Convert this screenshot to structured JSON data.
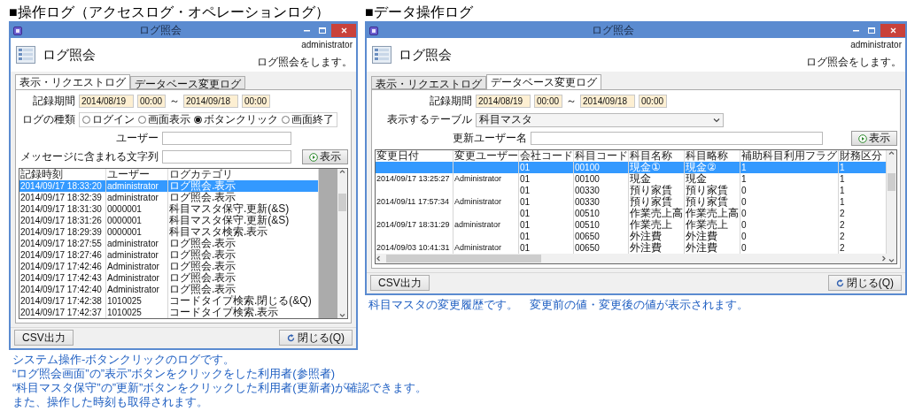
{
  "operation_log": {
    "heading": "■操作ログ（アクセスログ・オペレーションログ）",
    "window": {
      "title": "ログ照会",
      "user": "administrator",
      "page_title": "ログ照会",
      "description": "ログ照会をします。",
      "tabs": [
        {
          "label": "表示・リクエストログ",
          "selected": true
        },
        {
          "label": "データベース変更ログ",
          "selected": false
        }
      ],
      "footer_buttons": [
        {
          "kind": "csv",
          "label": "CSV出力"
        },
        {
          "kind": "close",
          "label": "閉じる(Q)"
        }
      ]
    },
    "form": {
      "period_label": "記録期間",
      "from_date": "2014/08/19",
      "from_time": "00:00",
      "tilde": "～",
      "to_date": "2014/09/18",
      "to_time": "00:00",
      "log_type_label": "ログの種類",
      "log_types": [
        {
          "label": "ログイン",
          "selected": false
        },
        {
          "label": "画面表示",
          "selected": false
        },
        {
          "label": "ボタンクリック",
          "selected": true
        },
        {
          "label": "画面終了",
          "selected": false
        }
      ],
      "user_label": "ユーザー",
      "message_label": "メッセージに含まれる文字列",
      "show_button": "表示"
    },
    "table": {
      "columns": [
        "記録時刻",
        "ユーザー",
        "ログカテゴリ"
      ],
      "rows": [
        {
          "cells": [
            "2014/09/17 18:33:20",
            "administrator",
            "ログ照会.表示"
          ],
          "selected": true
        },
        {
          "cells": [
            "2014/09/17 18:32:39",
            "administrator",
            "ログ照会.表示"
          ],
          "selected": false
        },
        {
          "cells": [
            "2014/09/17 18:31:30",
            "0000001",
            "科目マスタ保守.更新(&S)"
          ],
          "selected": false
        },
        {
          "cells": [
            "2014/09/17 18:31:26",
            "0000001",
            "科目マスタ保守.更新(&S)"
          ],
          "selected": false
        },
        {
          "cells": [
            "2014/09/17 18:29:39",
            "0000001",
            "科目マスタ検索.表示"
          ],
          "selected": false
        },
        {
          "cells": [
            "2014/09/17 18:27:55",
            "administrator",
            "ログ照会.表示"
          ],
          "selected": false
        },
        {
          "cells": [
            "2014/09/17 18:27:46",
            "administrator",
            "ログ照会.表示"
          ],
          "selected": false
        },
        {
          "cells": [
            "2014/09/17 17:42:46",
            "Administrator",
            "ログ照会.表示"
          ],
          "selected": false
        },
        {
          "cells": [
            "2014/09/17 17:42:43",
            "Administrator",
            "ログ照会.表示"
          ],
          "selected": false
        },
        {
          "cells": [
            "2014/09/17 17:42:40",
            "Administrator",
            "ログ照会.表示"
          ],
          "selected": false
        },
        {
          "cells": [
            "2014/09/17 17:42:38",
            "1010025",
            "コードタイプ検索.閉じる(&Q)"
          ],
          "selected": false
        },
        {
          "cells": [
            "2014/09/17 17:42:37",
            "1010025",
            "コードタイプ検索.表示"
          ],
          "selected": false
        }
      ]
    },
    "caption": [
      "システム操作-ボタンクリックのログです。",
      "“ログ照会画面”の”表示”ボタンをクリックをした利用者(参照者)",
      "“科目マスタ保守”の”更新”ボタンをクリックした利用者(更新者)が確認できます。",
      "また、操作した時刻も取得されます。"
    ]
  },
  "data_log": {
    "heading": "■データ操作ログ",
    "window": {
      "title": "ログ照会",
      "user": "administrator",
      "page_title": "ログ照会",
      "description": "ログ照会をします。",
      "tabs": [
        {
          "label": "表示・リクエストログ",
          "selected": false
        },
        {
          "label": "データベース変更ログ",
          "selected": true
        }
      ],
      "footer_buttons": [
        {
          "kind": "csv",
          "label": "CSV出力"
        },
        {
          "kind": "close",
          "label": "閉じる(Q)"
        }
      ]
    },
    "form": {
      "period_label": "記録期間",
      "from_date": "2014/08/19",
      "from_time": "00:00",
      "tilde": "～",
      "to_date": "2014/09/18",
      "to_time": "00:00",
      "table_label": "表示するテーブル",
      "table_value": "科目マスタ",
      "update_user_label": "更新ユーザー名",
      "show_button": "表示"
    },
    "table": {
      "columns": [
        "変更日付",
        "変更ユーザー",
        "会社コード",
        "科目コード",
        "科目名称",
        "科目略称",
        "補助科目利用フラグ",
        "財務区分"
      ],
      "rows": [
        {
          "cells": [
            "",
            "",
            "01",
            "00100",
            "現金①",
            "現金②",
            "1",
            "1"
          ],
          "selected": true
        },
        {
          "cells": [
            "2014/09/17 13:25:27",
            "Administrator",
            "01",
            "00100",
            "現金",
            "現金",
            "1",
            "1"
          ],
          "selected": false
        },
        {
          "cells": [
            "",
            "",
            "01",
            "00330",
            "預り家賃",
            "預り家賃",
            "0",
            "1"
          ],
          "selected": false
        },
        {
          "cells": [
            "2014/09/11 17:57:34",
            "Administrator",
            "01",
            "00330",
            "預り家賃",
            "預り家賃",
            "0",
            "1"
          ],
          "selected": false
        },
        {
          "cells": [
            "",
            "",
            "01",
            "00510",
            "作業売上高",
            "作業売上高",
            "0",
            "2"
          ],
          "selected": false
        },
        {
          "cells": [
            "2014/09/17 18:31:29",
            "administrator",
            "01",
            "00510",
            "作業売上",
            "作業売上",
            "0",
            "2"
          ],
          "selected": false
        },
        {
          "cells": [
            "",
            "",
            "01",
            "00650",
            "外注費",
            "外注費",
            "0",
            "2"
          ],
          "selected": false
        },
        {
          "cells": [
            "2014/09/03 10:41:31",
            "Administrator",
            "01",
            "00650",
            "外注費",
            "外注費",
            "0",
            "2"
          ],
          "selected": false
        }
      ]
    },
    "caption": [
      "科目マスタの変更履歴です。　変更前の値・変更後の値が表示されます。"
    ]
  }
}
